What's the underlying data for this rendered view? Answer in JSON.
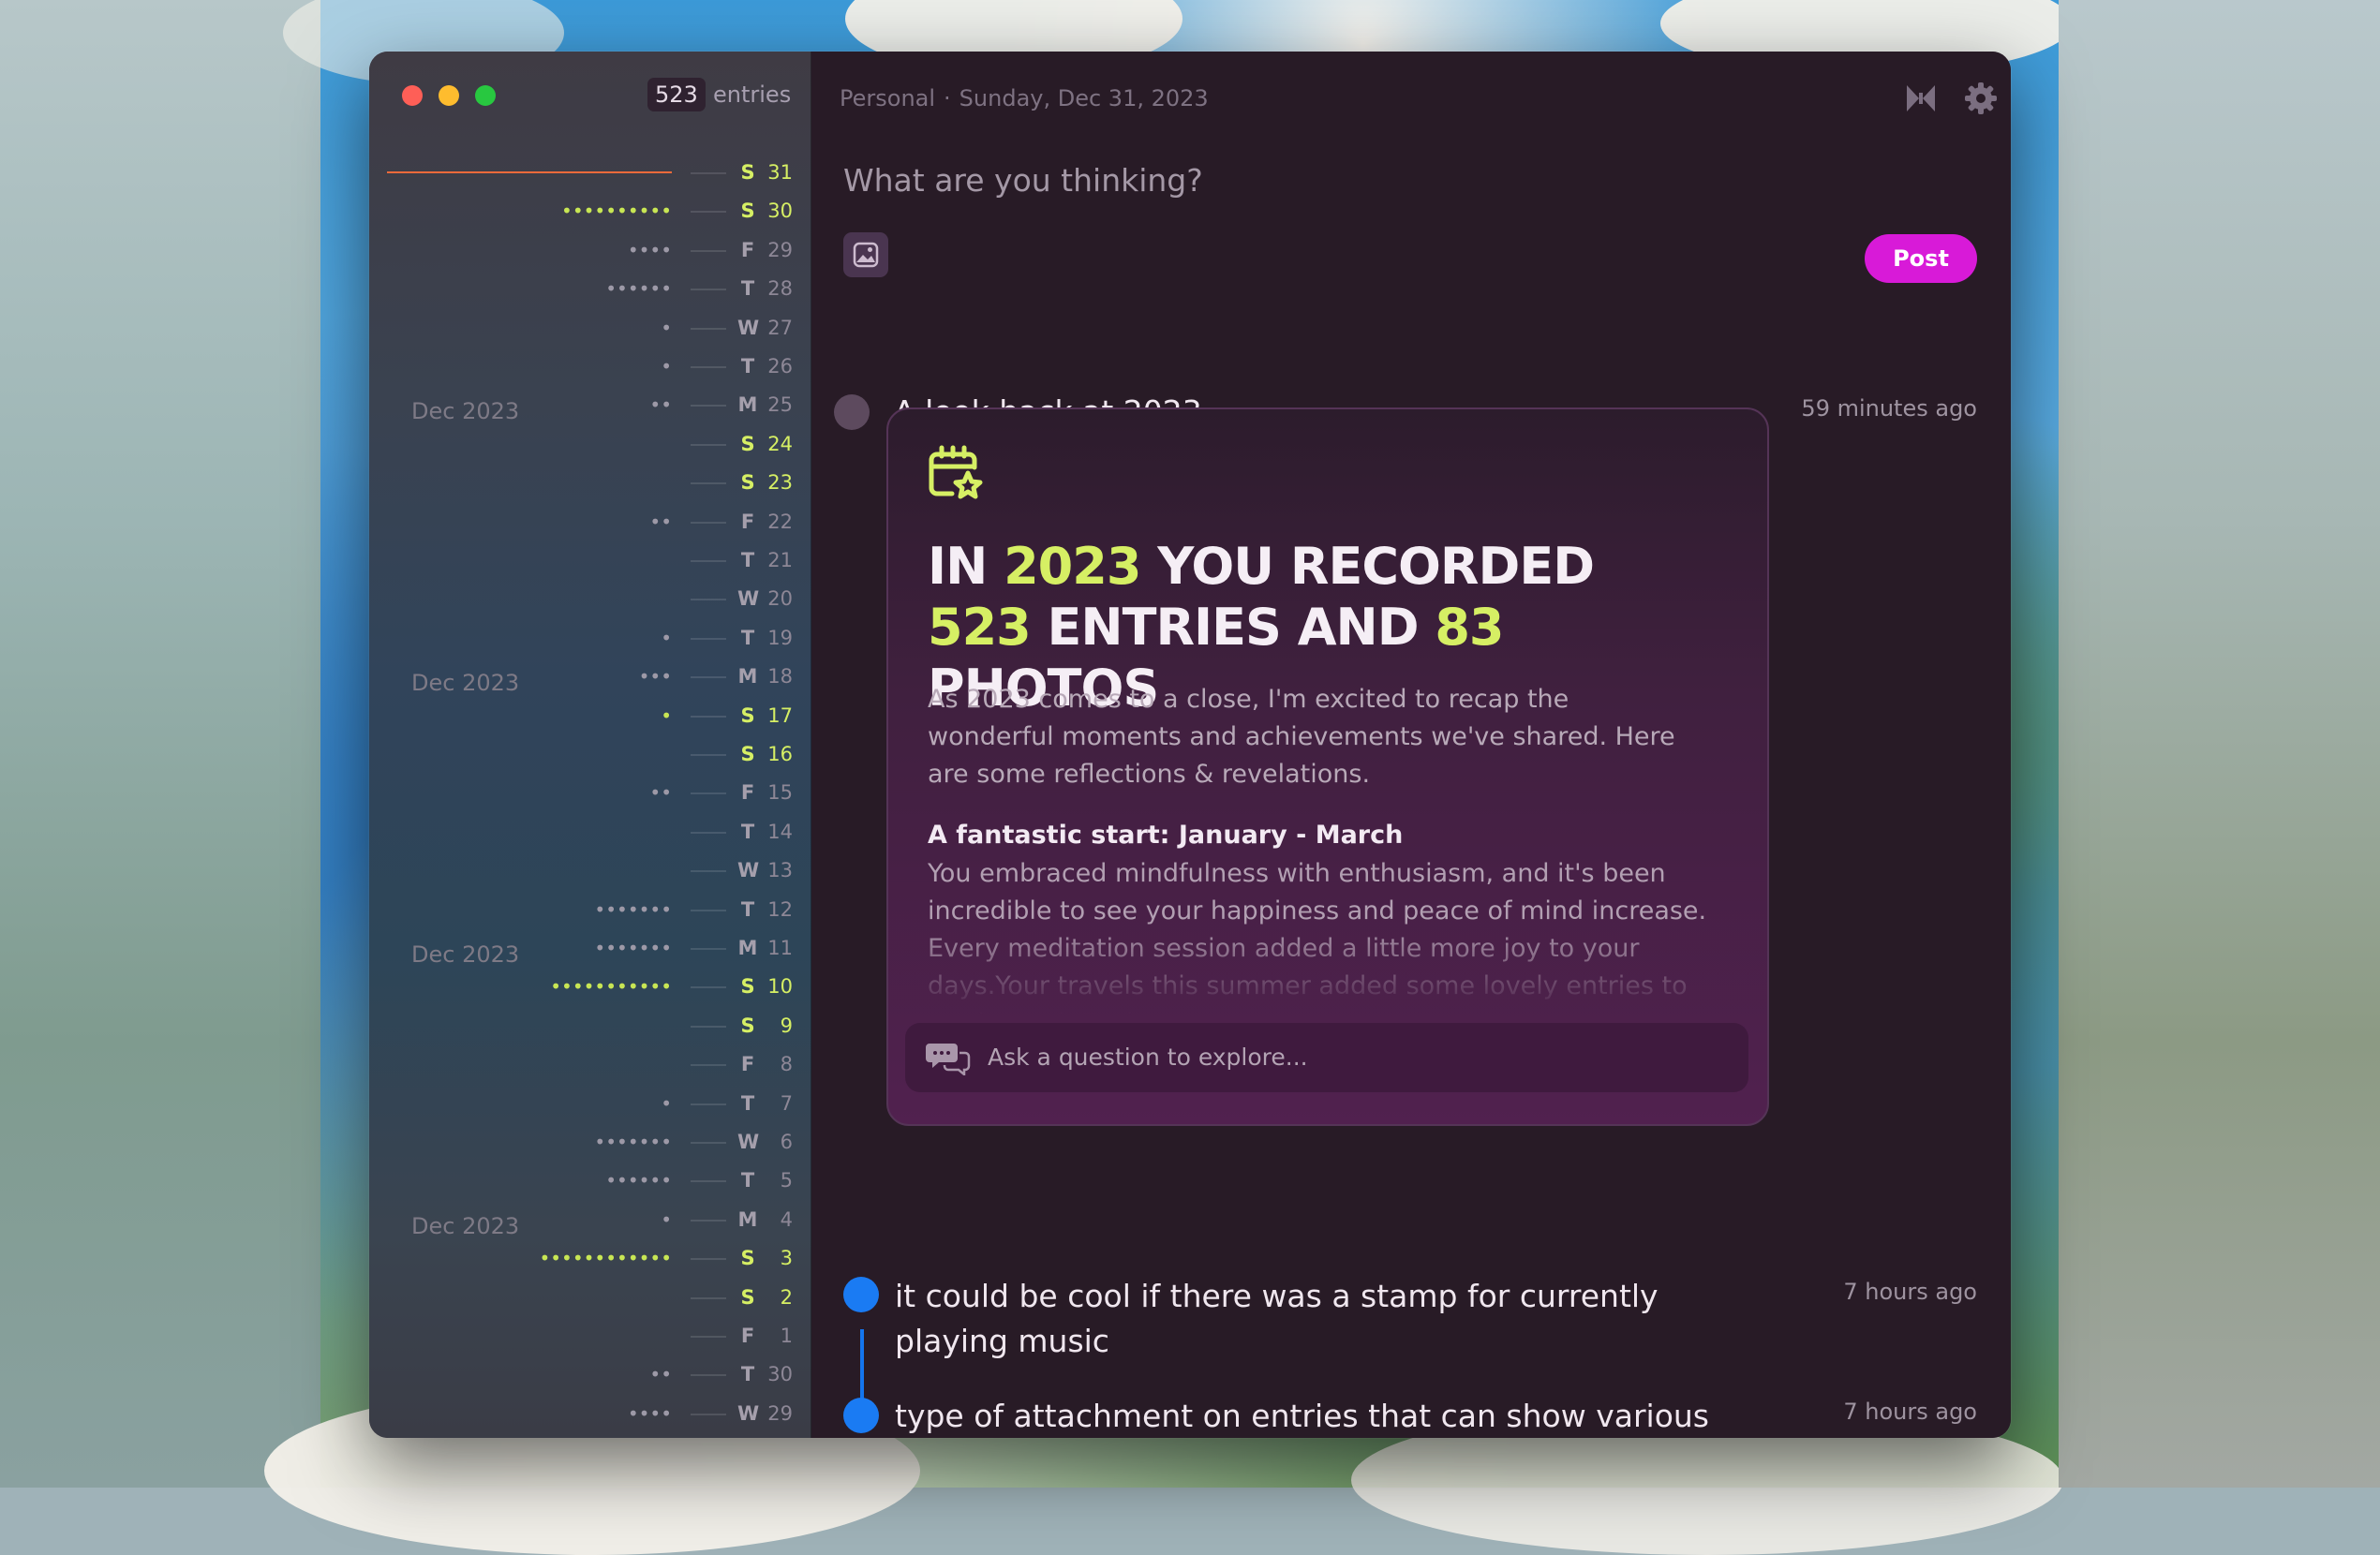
{
  "sidebar": {
    "entries_count": "523",
    "entries_label": "entries",
    "month_labels": [
      "Dec 2023",
      "Dec 2023",
      "Dec 2023",
      "Dec 2023"
    ],
    "days": [
      {
        "day": "S",
        "num": "31",
        "dots": "",
        "weekend": true,
        "today": true
      },
      {
        "day": "S",
        "num": "30",
        "dots": "••••••••••",
        "weekend": true
      },
      {
        "day": "F",
        "num": "29",
        "dots": "••••"
      },
      {
        "day": "T",
        "num": "28",
        "dots": "••••••"
      },
      {
        "day": "W",
        "num": "27",
        "dots": "•"
      },
      {
        "day": "T",
        "num": "26",
        "dots": "•"
      },
      {
        "day": "M",
        "num": "25",
        "dots": "••"
      },
      {
        "day": "S",
        "num": "24",
        "dots": "",
        "weekend": true
      },
      {
        "day": "S",
        "num": "23",
        "dots": "",
        "weekend": true
      },
      {
        "day": "F",
        "num": "22",
        "dots": "••"
      },
      {
        "day": "T",
        "num": "21",
        "dots": ""
      },
      {
        "day": "W",
        "num": "20",
        "dots": ""
      },
      {
        "day": "T",
        "num": "19",
        "dots": "•"
      },
      {
        "day": "M",
        "num": "18",
        "dots": "•••"
      },
      {
        "day": "S",
        "num": "17",
        "dots": "•",
        "weekend": true
      },
      {
        "day": "S",
        "num": "16",
        "dots": "",
        "weekend": true
      },
      {
        "day": "F",
        "num": "15",
        "dots": "••"
      },
      {
        "day": "T",
        "num": "14",
        "dots": ""
      },
      {
        "day": "W",
        "num": "13",
        "dots": ""
      },
      {
        "day": "T",
        "num": "12",
        "dots": "•••••••"
      },
      {
        "day": "M",
        "num": "11",
        "dots": "•••••••"
      },
      {
        "day": "S",
        "num": "10",
        "dots": "•••••••••••",
        "weekend": true
      },
      {
        "day": "S",
        "num": "9",
        "dots": "",
        "weekend": true
      },
      {
        "day": "F",
        "num": "8",
        "dots": ""
      },
      {
        "day": "T",
        "num": "7",
        "dots": "•"
      },
      {
        "day": "W",
        "num": "6",
        "dots": "•••••••"
      },
      {
        "day": "T",
        "num": "5",
        "dots": "••••••"
      },
      {
        "day": "M",
        "num": "4",
        "dots": "•"
      },
      {
        "day": "S",
        "num": "3",
        "dots": "••••••••••••",
        "weekend": true
      },
      {
        "day": "S",
        "num": "2",
        "dots": "",
        "weekend": true
      },
      {
        "day": "F",
        "num": "1",
        "dots": ""
      },
      {
        "day": "T",
        "num": "30",
        "dots": "••"
      },
      {
        "day": "W",
        "num": "29",
        "dots": "••••"
      }
    ]
  },
  "header": {
    "journal": "Personal",
    "separator": "·",
    "date": "Sunday, Dec 31, 2023",
    "icons": [
      "bowtie-icon",
      "gear-icon",
      "home-icon"
    ]
  },
  "composer": {
    "placeholder": "What are you thinking?",
    "image_icon": "image-icon",
    "post_label": "Post"
  },
  "entries": [
    {
      "title": "A look back at 2023",
      "time": "59 minutes ago",
      "dot_color": "#5d4a5e"
    },
    {
      "title": "it could be cool if there was a stamp for currently playing music",
      "time": "7 hours ago",
      "dot_color": "#1a7bf3"
    },
    {
      "title": "type of attachment on entries that can show various content - eg: a music card or a reflection card. They are",
      "time": "7 hours ago",
      "dot_color": "#1a7bf3"
    }
  ],
  "card": {
    "icon": "calendar-star-icon",
    "headline": {
      "p1": "IN ",
      "year": "2023",
      "p2": " YOU RECORDED",
      "entries": "523",
      "p3": " ENTRIES AND ",
      "photos": "83",
      "p4": " PHOTOS"
    },
    "intro": "As 2023 comes to a close, I'm excited to recap the wonderful moments and achievements we've shared. Here are some reflections & revelations.",
    "section_title": "A fantastic start: January - March",
    "section_body": "You embraced mindfulness with enthusiasm, and it's been incredible to see your happiness and peace of mind increase. Every meditation session added a little more joy to your days.Your travels this summer added some lovely entries to our journal. Each",
    "ask_placeholder": "Ask a question to explore...",
    "ask_icon": "chat-bubbles-icon"
  },
  "colors": {
    "accent": "#d81ad8",
    "highlight": "#d6ef64",
    "today_line": "#ef6a3b"
  }
}
